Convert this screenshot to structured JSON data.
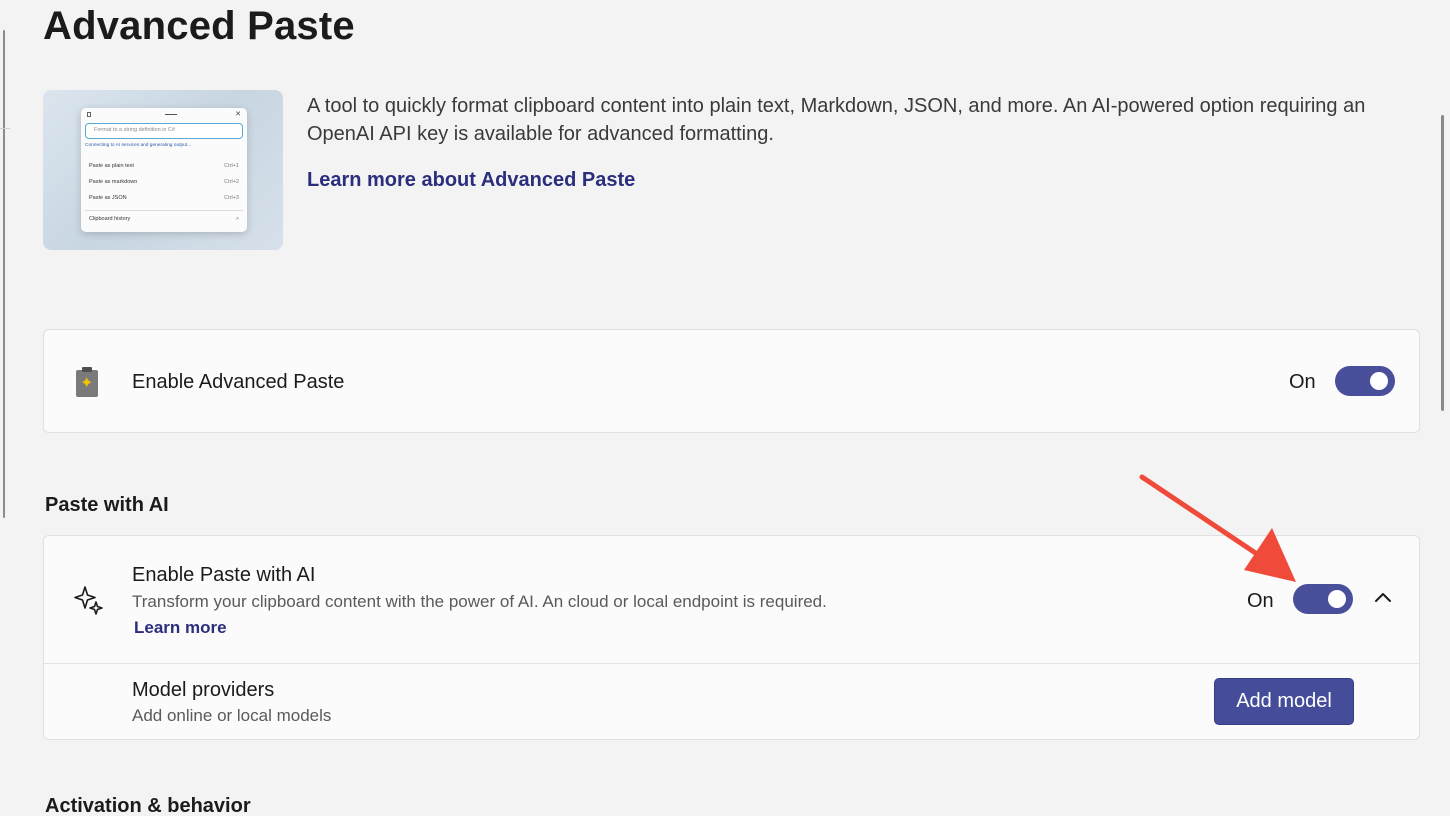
{
  "page": {
    "title": "Advanced Paste"
  },
  "hero": {
    "preview": {
      "search_placeholder": "Format to a string definition in C#",
      "status": "Connecting to AI services and generating output...",
      "items": [
        {
          "label": "Paste as plain text",
          "shortcut": "Ctrl+1"
        },
        {
          "label": "Paste as markdown",
          "shortcut": "Ctrl+2"
        },
        {
          "label": "Paste as JSON",
          "shortcut": "Ctrl+3"
        }
      ],
      "history_label": "Clipboard history",
      "history_chevron": ">"
    },
    "description": "A tool to quickly format clipboard content into plain text, Markdown, JSON, and more. An AI-powered option requiring an OpenAI API key is available for advanced formatting.",
    "learn_more": "Learn more about Advanced Paste"
  },
  "enable_card": {
    "icon": "clipboard-sparkle-icon",
    "title": "Enable Advanced Paste",
    "toggle_state": "On",
    "toggle_on": true
  },
  "paste_ai_section": {
    "header": "Paste with AI",
    "enable_row": {
      "icon": "sparkle-icon",
      "title": "Enable Paste with AI",
      "description": "Transform your clipboard content with the power of AI. An cloud or local endpoint is required.",
      "learn_more": "Learn more",
      "toggle_state": "On",
      "toggle_on": true,
      "expanded": true
    },
    "model_row": {
      "title": "Model providers",
      "description": "Add online or local models",
      "button_label": "Add model"
    }
  },
  "activation_section": {
    "header": "Activation & behavior"
  },
  "colors": {
    "accent": "#4a4f9c",
    "link": "#2b2e7c",
    "annotation_arrow": "#f04a3a"
  }
}
